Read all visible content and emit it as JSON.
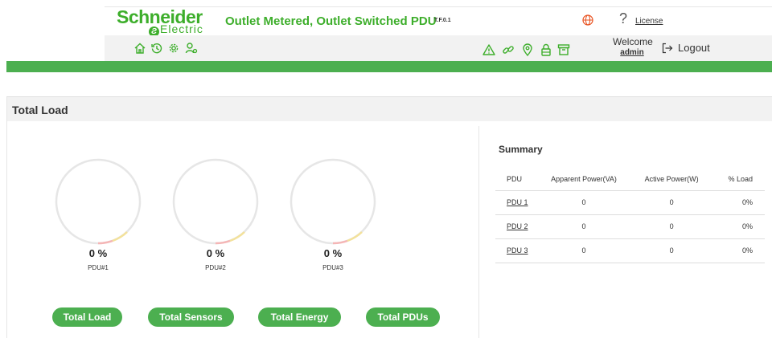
{
  "brand": {
    "name": "Schneider",
    "sub": "Electric"
  },
  "product": {
    "title": "Outlet Metered, Outlet Switched PDU",
    "version": "T.F.0.1"
  },
  "header": {
    "license_label": "License",
    "help_glyph": "?"
  },
  "nav_icons": [
    "home-icon",
    "history-icon",
    "settings-icon",
    "users-icon"
  ],
  "status_icons": [
    "warning-icon",
    "link-icon",
    "location-icon",
    "lock-icon",
    "archive-icon"
  ],
  "user": {
    "welcome": "Welcome",
    "name": "admin",
    "logout_label": "Logout"
  },
  "panel": {
    "title": "Total Load"
  },
  "gauges": [
    {
      "value": "0 %",
      "label": "PDU#1"
    },
    {
      "value": "0 %",
      "label": "PDU#2"
    },
    {
      "value": "0 %",
      "label": "PDU#3"
    }
  ],
  "buttons": [
    "Total Load",
    "Total Sensors",
    "Total Energy",
    "Total PDUs"
  ],
  "summary": {
    "title": "Summary",
    "columns": [
      "PDU",
      "Apparent Power(VA)",
      "Active Power(W)",
      "% Load"
    ],
    "rows": [
      [
        "PDU 1",
        "0",
        "0",
        "0%"
      ],
      [
        "PDU 2",
        "0",
        "0",
        "0%"
      ],
      [
        "PDU 3",
        "0",
        "0",
        "0%"
      ]
    ]
  },
  "colors": {
    "brand_green": "#3dae2b",
    "band_green": "#4caf50",
    "gauge_warn": "#f5b5b5",
    "gauge_ok": "#f3e19a"
  }
}
